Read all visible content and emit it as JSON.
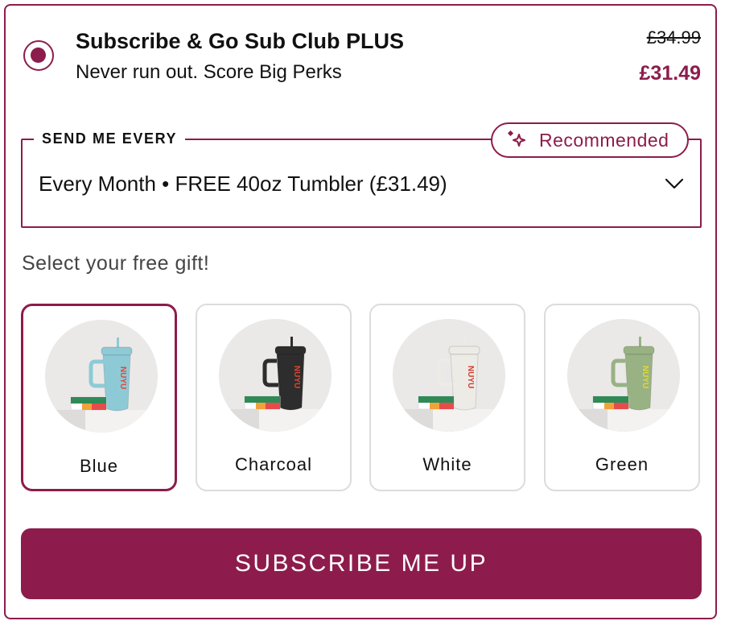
{
  "plan": {
    "title": "Subscribe & Go Sub Club PLUS",
    "subtitle": "Never run out. Score Big Perks",
    "original_price": "£34.99",
    "price": "£31.49",
    "selected": true
  },
  "frequency": {
    "label": "SEND ME EVERY",
    "badge": "Recommended",
    "badge_icon": "sparkle-icon",
    "value": "Every Month • FREE 40oz Tumbler (£31.49)",
    "dropdown_icon": "chevron-down-icon"
  },
  "gift": {
    "heading": "Select your free gift!",
    "options": [
      {
        "name": "Blue",
        "color": "#8ecad6",
        "text_color": "#e2473a",
        "selected": true
      },
      {
        "name": "Charcoal",
        "color": "#2d2d2d",
        "text_color": "#d9482f",
        "selected": false
      },
      {
        "name": "White",
        "color": "#ecebe6",
        "text_color": "#d43c2f",
        "selected": false
      },
      {
        "name": "Green",
        "color": "#98b284",
        "text_color": "#e3d634",
        "selected": false
      }
    ]
  },
  "cta": {
    "label": "SUBSCRIBE ME UP"
  },
  "colors": {
    "accent": "#8d1c4c",
    "border_muted": "#dcdcdc"
  }
}
